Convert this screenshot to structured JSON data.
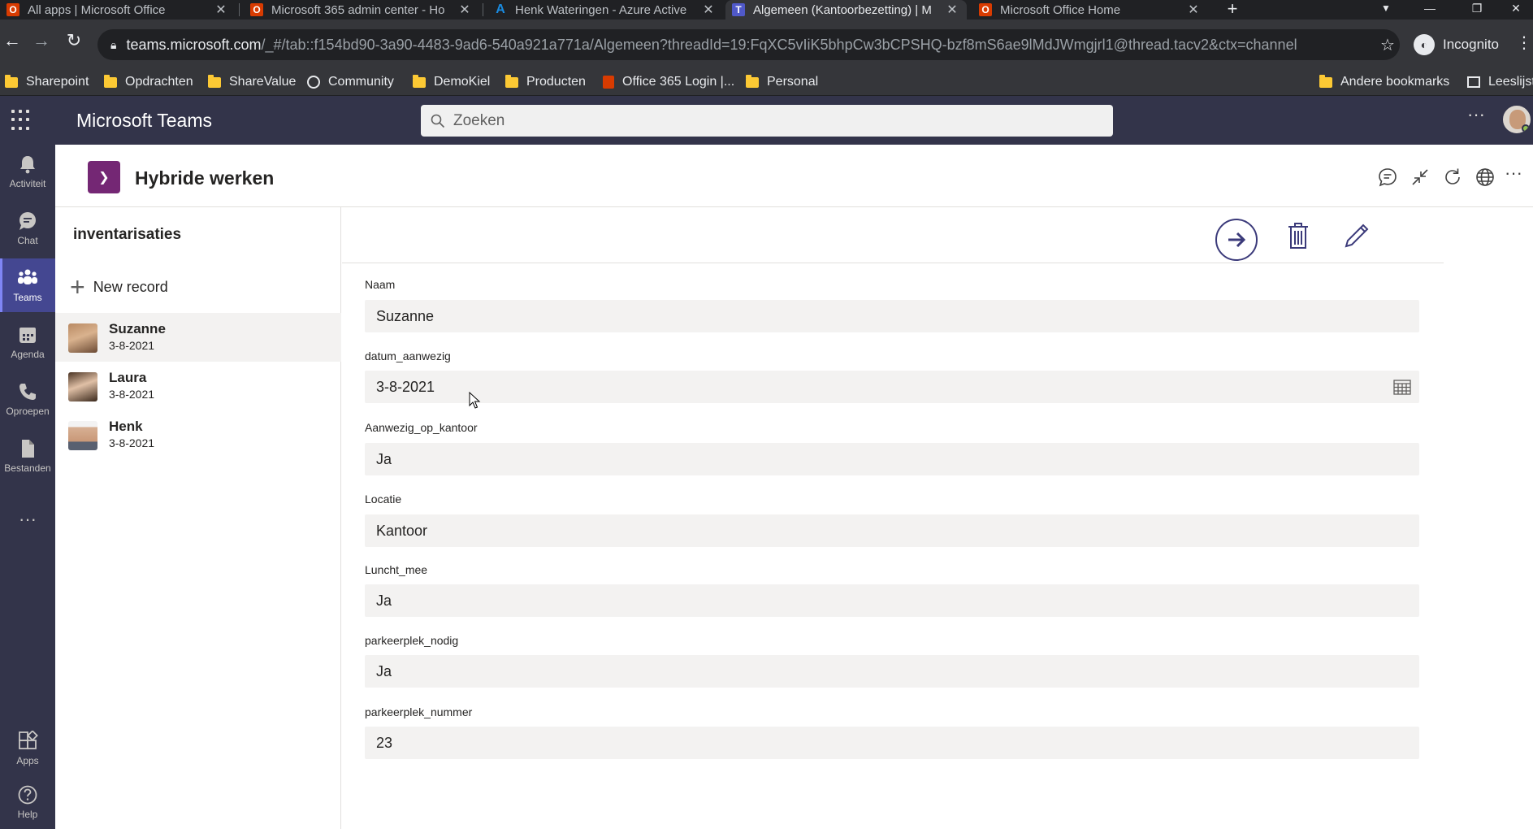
{
  "browser": {
    "tabs": [
      {
        "title": "All apps | Microsoft Office",
        "favicon": "office-icon"
      },
      {
        "title": "Microsoft 365 admin center - Ho",
        "favicon": "office-icon"
      },
      {
        "title": "Henk Wateringen - Azure Active",
        "favicon": "azure-icon"
      },
      {
        "title": "Algemeen (Kantoorbezetting) | M",
        "favicon": "teams-icon",
        "active": true
      },
      {
        "title": "Microsoft Office Home",
        "favicon": "office-icon"
      }
    ],
    "url_host": "teams.microsoft.com",
    "url_path": "/_#/tab::f154bd90-3a90-4483-9ad6-540a921a771a/Algemeen?threadId=19:FqXC5vIiK5bhpCw3bCPSHQ-bzf8mS6ae9lMdJWmgjrl1@thread.tacv2&ctx=channel",
    "incognito_label": "Incognito",
    "bookmarks": [
      "Sharepoint",
      "Opdrachten",
      "ShareValue",
      "Community",
      "DemoKiel",
      "Producten",
      "Office 365 Login |...",
      "Personal"
    ],
    "other_bookmarks": "Andere bookmarks",
    "reading_list": "Leeslijst"
  },
  "teams": {
    "app_title": "Microsoft Teams",
    "search_placeholder": "Zoeken",
    "rail": [
      {
        "label": "Activiteit",
        "icon": "bell-icon"
      },
      {
        "label": "Chat",
        "icon": "chat-icon"
      },
      {
        "label": "Teams",
        "icon": "teams-icon",
        "active": true
      },
      {
        "label": "Agenda",
        "icon": "calendar-icon"
      },
      {
        "label": "Oproepen",
        "icon": "phone-icon"
      },
      {
        "label": "Bestanden",
        "icon": "file-icon"
      },
      {
        "label": "Apps",
        "icon": "apps-icon"
      },
      {
        "label": "Help",
        "icon": "help-icon"
      }
    ],
    "tab_title": "Hybride werken"
  },
  "list": {
    "title": "inventarisaties",
    "new_record": "New record",
    "items": [
      {
        "name": "Suzanne",
        "date": "3-8-2021",
        "selected": true
      },
      {
        "name": "Laura",
        "date": "3-8-2021"
      },
      {
        "name": "Henk",
        "date": "3-8-2021"
      }
    ]
  },
  "form": {
    "fields": [
      {
        "label": "Naam",
        "value": "Suzanne"
      },
      {
        "label": "datum_aanwezig",
        "value": "3-8-2021"
      },
      {
        "label": "Aanwezig_op_kantoor",
        "value": "Ja"
      },
      {
        "label": "Locatie",
        "value": "Kantoor"
      },
      {
        "label": "Luncht_mee",
        "value": "Ja"
      },
      {
        "label": "parkeerplek_nodig",
        "value": "Ja"
      },
      {
        "label": "parkeerplek_nummer",
        "value": "23"
      }
    ]
  },
  "colors": {
    "teams_header": "#33344a",
    "rail_active": "#444791",
    "app_icon": "#742774",
    "field_bg": "#f3f2f1"
  }
}
